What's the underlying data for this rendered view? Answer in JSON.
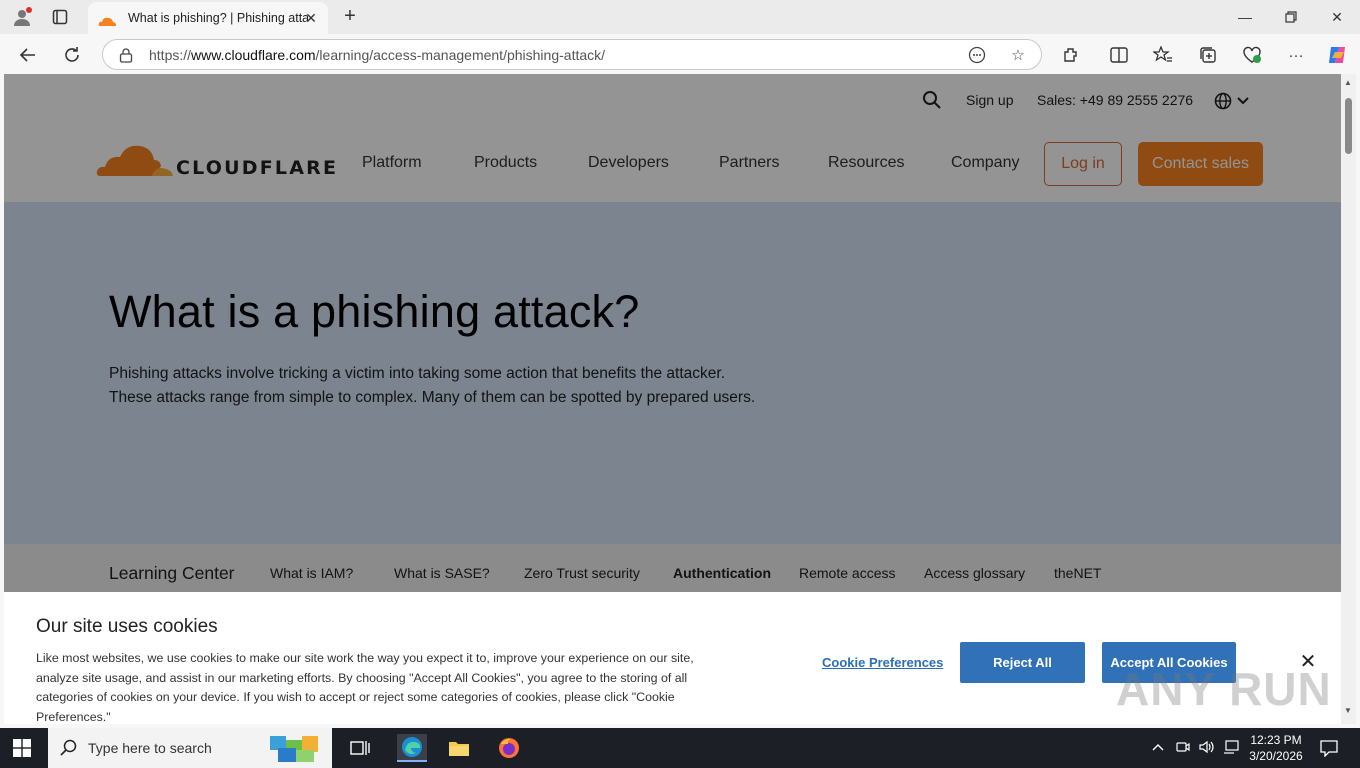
{
  "browser": {
    "tab": {
      "title": "What is phishing? | Phishing attac"
    },
    "url": {
      "prefix": "https://",
      "domain": "www.cloudflare.com",
      "path": "/learning/access-management/phishing-attack/"
    }
  },
  "header": {
    "sign_up": "Sign up",
    "sales": "Sales: +49 89 2555 2276",
    "logo_text": "CLOUDFLARE",
    "nav": [
      "Platform",
      "Products",
      "Developers",
      "Partners",
      "Resources",
      "Company"
    ],
    "login": "Log in",
    "contact": "Contact sales"
  },
  "hero": {
    "title": "What is a phishing attack?",
    "description": "Phishing attacks involve tricking a victim into taking some action that benefits the attacker. These attacks range from simple to complex. Many of them can be spotted by prepared users."
  },
  "learning_center": {
    "title": "Learning Center",
    "links": [
      "What is IAM?",
      "What is SASE?",
      "Zero Trust security",
      "Authentication",
      "Remote access",
      "Access glossary",
      "theNET"
    ]
  },
  "cookie_banner": {
    "title": "Our site uses cookies",
    "text": "Like most websites, we use cookies to make our site work the way you expect it to, improve your experience on our site, analyze site usage, and assist in our marketing efforts. By choosing \"Accept All Cookies\", you agree to the storing of all categories of cookies on your device. If you wish to accept or reject some categories of cookies, please click \"Cookie Preferences.\"",
    "preferences": "Cookie Preferences",
    "reject": "Reject All",
    "accept": "Accept All Cookies",
    "close": "✕"
  },
  "watermark": "ANY RUN",
  "taskbar": {
    "search_placeholder": "Type here to search",
    "time": "12:23 PM",
    "date": "3/20/2026"
  },
  "colors": {
    "accent": "#f6821f",
    "hero_bg": "#d4e4f6",
    "cookie_button": "#3071b7"
  }
}
